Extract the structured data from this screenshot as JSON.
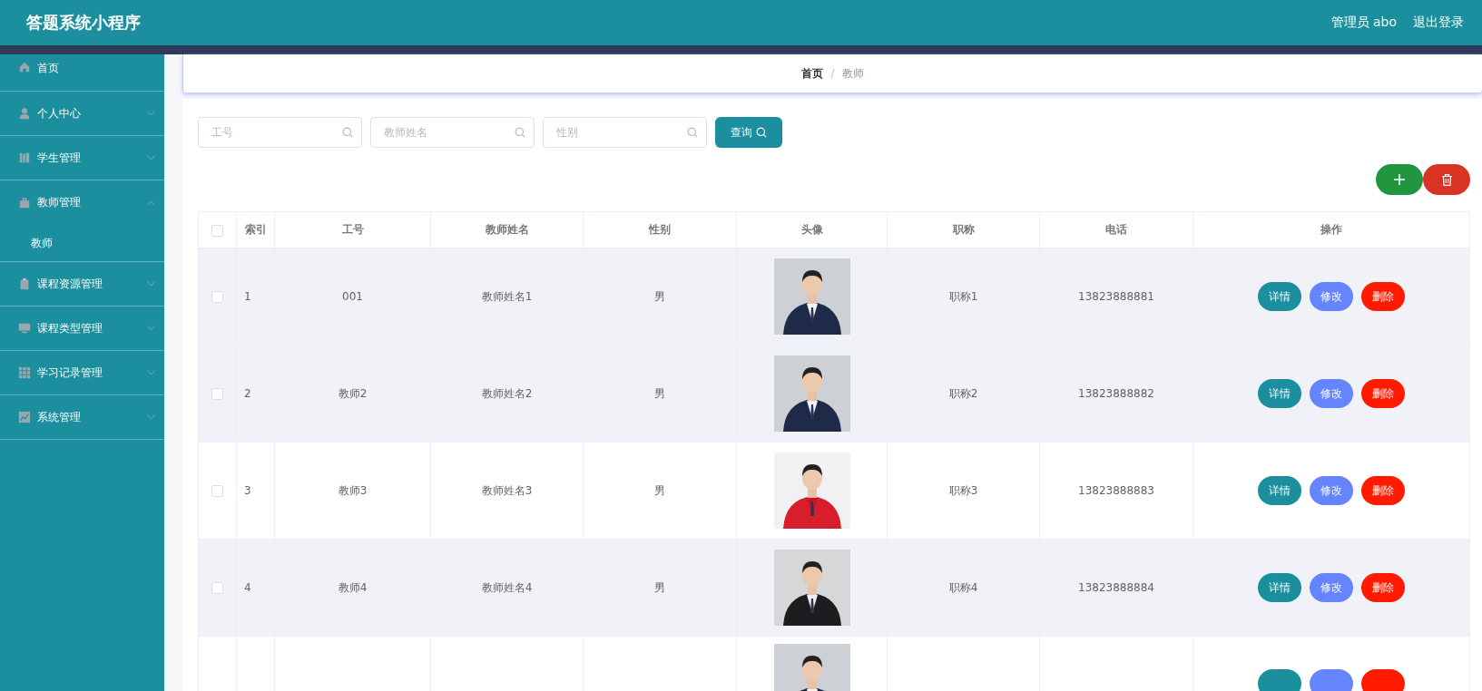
{
  "header": {
    "title": "答题系统小程序",
    "user": "管理员 abo",
    "logout": "退出登录"
  },
  "sidebar": {
    "items": [
      {
        "label": "首页",
        "kind": "link",
        "expanded": false
      },
      {
        "label": "个人中心",
        "kind": "menu",
        "expanded": false
      },
      {
        "label": "学生管理",
        "kind": "menu",
        "expanded": false
      },
      {
        "label": "教师管理",
        "kind": "menu",
        "expanded": true,
        "children": [
          {
            "label": "教师"
          }
        ]
      },
      {
        "label": "课程资源管理",
        "kind": "menu",
        "expanded": false
      },
      {
        "label": "课程类型管理",
        "kind": "menu",
        "expanded": false
      },
      {
        "label": "学习记录管理",
        "kind": "menu",
        "expanded": false
      },
      {
        "label": "系统管理",
        "kind": "menu",
        "expanded": false
      }
    ]
  },
  "breadcrumb": {
    "separator": "/",
    "items": [
      {
        "label": "首页",
        "selected": false
      },
      {
        "label": "教师",
        "selected": true
      }
    ]
  },
  "search": {
    "fields": [
      {
        "placeholder": "工号"
      },
      {
        "placeholder": "教师姓名"
      },
      {
        "placeholder": "性别"
      }
    ],
    "button": "查询"
  },
  "table": {
    "select_all": {
      "checked": false
    },
    "columns": [
      "索引",
      "工号",
      "教师姓名",
      "性别",
      "头像",
      "职称",
      "电话",
      "操作"
    ],
    "rows": [
      {
        "kind": "full",
        "highlighted": true,
        "checked": false,
        "cells": [
          "1",
          "001",
          "教师姓名1",
          "男",
          "职称1",
          "13823888881"
        ],
        "actions": [
          "详情",
          "修改",
          "删除"
        ]
      },
      {
        "kind": "full",
        "highlighted": true,
        "checked": false,
        "cells": [
          "2",
          "教师2",
          "教师姓名2",
          "男",
          "职称2",
          "13823888882"
        ],
        "actions": [
          "详情",
          "修改",
          "删除"
        ]
      },
      {
        "kind": "full",
        "highlighted": false,
        "checked": false,
        "cells": [
          "3",
          "教师3",
          "教师姓名3",
          "男",
          "职称3",
          "13823888883"
        ],
        "actions": [
          "详情",
          "修改",
          "删除"
        ]
      },
      {
        "kind": "full",
        "highlighted": true,
        "checked": false,
        "cells": [
          "4",
          "教师4",
          "教师姓名4",
          "男",
          "职称4",
          "13823888884"
        ],
        "actions": [
          "详情",
          "修改",
          "删除"
        ]
      },
      {
        "kind": "partial",
        "highlighted": false
      }
    ]
  }
}
